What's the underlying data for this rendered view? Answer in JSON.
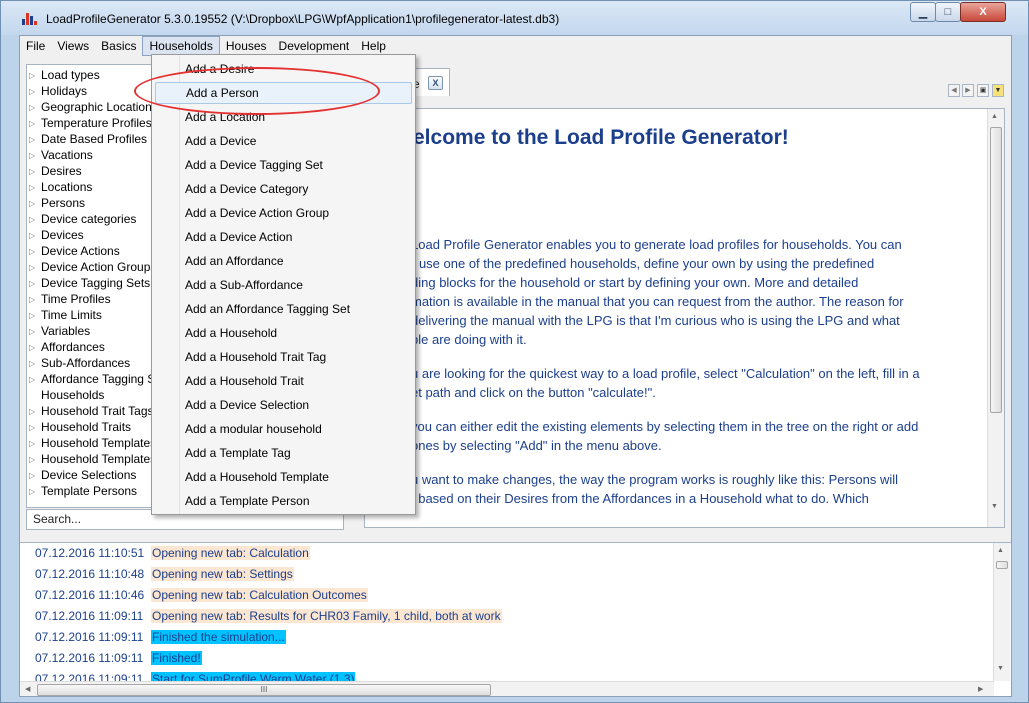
{
  "window": {
    "title": "LoadProfileGenerator 5.3.0.19552 (V:\\Dropbox\\LPG\\WpfApplication1\\profilegenerator-latest.db3)",
    "minimize": "▁",
    "maximize": "□",
    "close": "X"
  },
  "menu": [
    "File",
    "Views",
    "Basics",
    "Households",
    "Houses",
    "Development",
    "Help"
  ],
  "tree": [
    {
      "label": "Load types",
      "arrow": true
    },
    {
      "label": "Holidays",
      "arrow": true
    },
    {
      "label": "Geographic Locations",
      "arrow": true
    },
    {
      "label": "Temperature Profiles",
      "arrow": true
    },
    {
      "label": "Date Based Profiles",
      "arrow": true
    },
    {
      "label": "Vacations",
      "arrow": true
    },
    {
      "label": "Desires",
      "arrow": true
    },
    {
      "label": "Locations",
      "arrow": true
    },
    {
      "label": "Persons",
      "arrow": true
    },
    {
      "label": "Device categories",
      "arrow": true
    },
    {
      "label": "Devices",
      "arrow": true
    },
    {
      "label": "Device Actions",
      "arrow": true
    },
    {
      "label": "Device Action Groups",
      "arrow": true
    },
    {
      "label": "Device Tagging Sets",
      "arrow": true
    },
    {
      "label": "Time Profiles",
      "arrow": true
    },
    {
      "label": "Time Limits",
      "arrow": true
    },
    {
      "label": "Variables",
      "arrow": true
    },
    {
      "label": "Affordances",
      "arrow": true
    },
    {
      "label": "Sub-Affordances",
      "arrow": true
    },
    {
      "label": "Affordance Tagging Sets",
      "arrow": true
    },
    {
      "label": "Households",
      "arrow": false
    },
    {
      "label": "Household Trait Tags",
      "arrow": true
    },
    {
      "label": "Household Traits",
      "arrow": true
    },
    {
      "label": "Household Templates",
      "arrow": true
    },
    {
      "label": "Household Templates",
      "arrow": true
    },
    {
      "label": "Device Selections",
      "arrow": true
    },
    {
      "label": "Template Persons",
      "arrow": true
    }
  ],
  "search": {
    "placeholder": "Search..."
  },
  "tab": {
    "label": "e",
    "close": "X"
  },
  "content": {
    "title": "elcome to the Load Profile Generator!",
    "lines": [
      "Load Profile Generator enables you to generate load profiles for households. You can",
      "r use one of the predefined households, define your own by using the predefined",
      "ding blocks for the household or start by defining your own. More and detailed",
      "mation is available in the manual that you can request from the author. The reason for",
      "delivering the manual with the LPG is that I'm curious who is using the LPG and what",
      "ble are doing with it.",
      "",
      "u are looking for the quickest way to a load profile, select \"Calculation\" on the left, fill in a",
      "et path and click on the button \"calculate!\".",
      "",
      "you can either edit the existing elements by selecting them in the tree on the right or add",
      "ones by selecting \"Add\" in the menu above.",
      "",
      "u want to make changes, the way the program works is roughly like this: Persons will",
      "t based on their Desires from the Affordances in a Household what to do. Which"
    ]
  },
  "log": [
    {
      "time": "07.12.2016 11:10:51",
      "message": "Opening new tab: Calculation",
      "style": "peach"
    },
    {
      "time": "07.12.2016 11:10:48",
      "message": "Opening new tab: Settings",
      "style": "peach"
    },
    {
      "time": "07.12.2016 11:10:46",
      "message": "Opening new tab: Calculation Outcomes",
      "style": "peach"
    },
    {
      "time": "07.12.2016 11:09:11",
      "message": "Opening new tab: Results for CHR03 Family, 1 child, both at work",
      "style": "peach"
    },
    {
      "time": "07.12.2016 11:09:11",
      "message": "Finished the simulation...",
      "style": "cyan"
    },
    {
      "time": "07.12.2016 11:09:11",
      "message": "Finished!",
      "style": "cyan"
    },
    {
      "time": "07.12.2016 11:09:11",
      "message": "Start for SumProfile Warm Water (1.3)",
      "style": "cyan"
    }
  ],
  "dropdown": {
    "items": [
      "Add a Desire",
      "Add a Person",
      "Add a Location",
      "Add a Device",
      "Add a Device Tagging Set",
      "Add a Device Category",
      "Add a Device Action Group",
      "Add a Device Action",
      "Add an Affordance",
      "Add a Sub-Affordance",
      "Add an Affordance Tagging Set",
      "Add a Household",
      "Add a Household Trait Tag",
      "Add a Household Trait",
      "Add a Device Selection",
      "Add a modular household",
      "Add a Template Tag",
      "Add a Household Template",
      "Add a Template Person"
    ],
    "highlighted_index": 1
  },
  "scroll": {
    "hthumb_grip": "III"
  },
  "colors": {
    "accent_text": "#1c3f8c",
    "log_peach": "#fbe6d2",
    "log_cyan": "#00c2ff",
    "annotation_red": "#e53030"
  }
}
